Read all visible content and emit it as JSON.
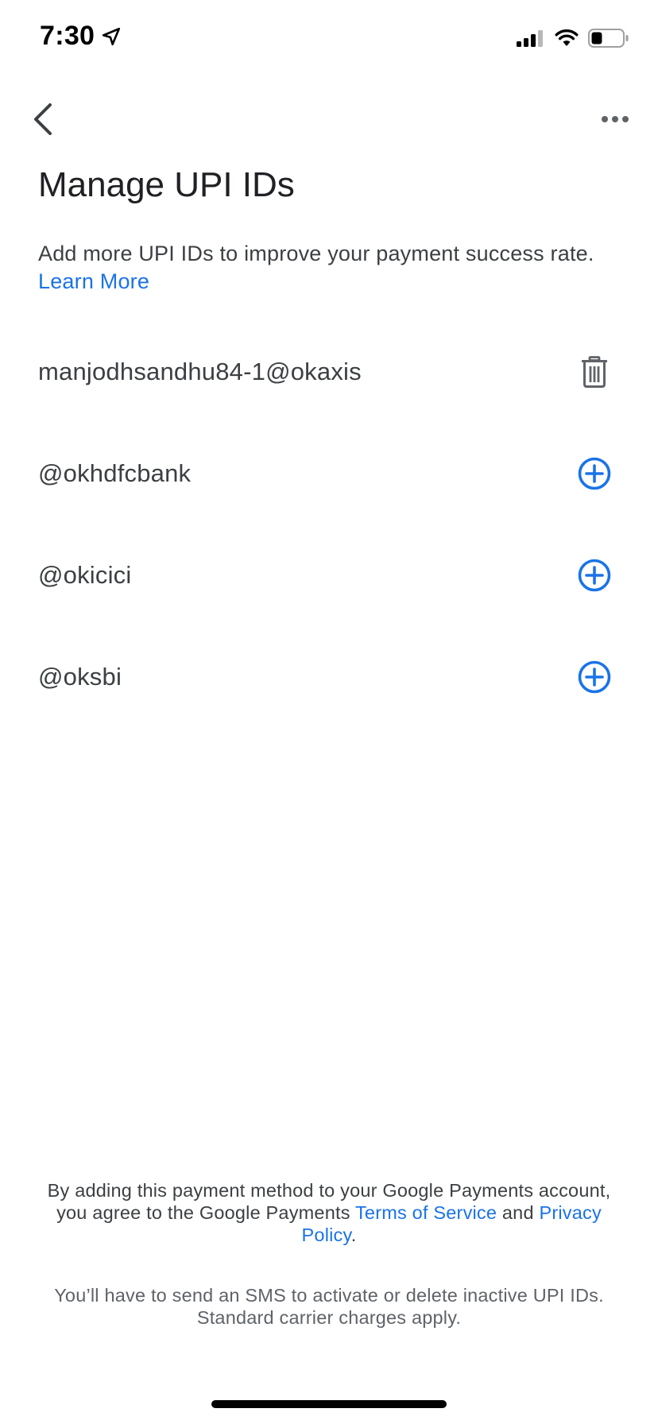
{
  "status_bar": {
    "time": "7:30",
    "battery_level": 0.35
  },
  "header": {
    "title": "Manage UPI IDs"
  },
  "description": {
    "text": "Add more UPI IDs to improve your payment success rate.",
    "link_label": "Learn More"
  },
  "upi_ids": [
    {
      "label": "manjodhsandhu84-1@okaxis",
      "action": "delete-icon"
    },
    {
      "label": "@okhdfcbank",
      "action": "add-circle-icon"
    },
    {
      "label": "@okicici",
      "action": "add-circle-icon"
    },
    {
      "label": "@oksbi",
      "action": "add-circle-icon"
    }
  ],
  "footer": {
    "terms_prefix": "By adding this payment method to your Google Payments account, you agree to the Google Payments",
    "terms_link": "Terms of Service",
    "terms_and": "and",
    "privacy_link": "Privacy Policy",
    "terms_suffix": ".",
    "sms_notice": "You’ll have to send an SMS to activate or delete inactive UPI IDs. Standard carrier charges apply."
  },
  "colors": {
    "accent": "#1a73e8",
    "text_primary": "#202124",
    "text_secondary": "#3c4043",
    "icon_gray": "#5f6368"
  }
}
